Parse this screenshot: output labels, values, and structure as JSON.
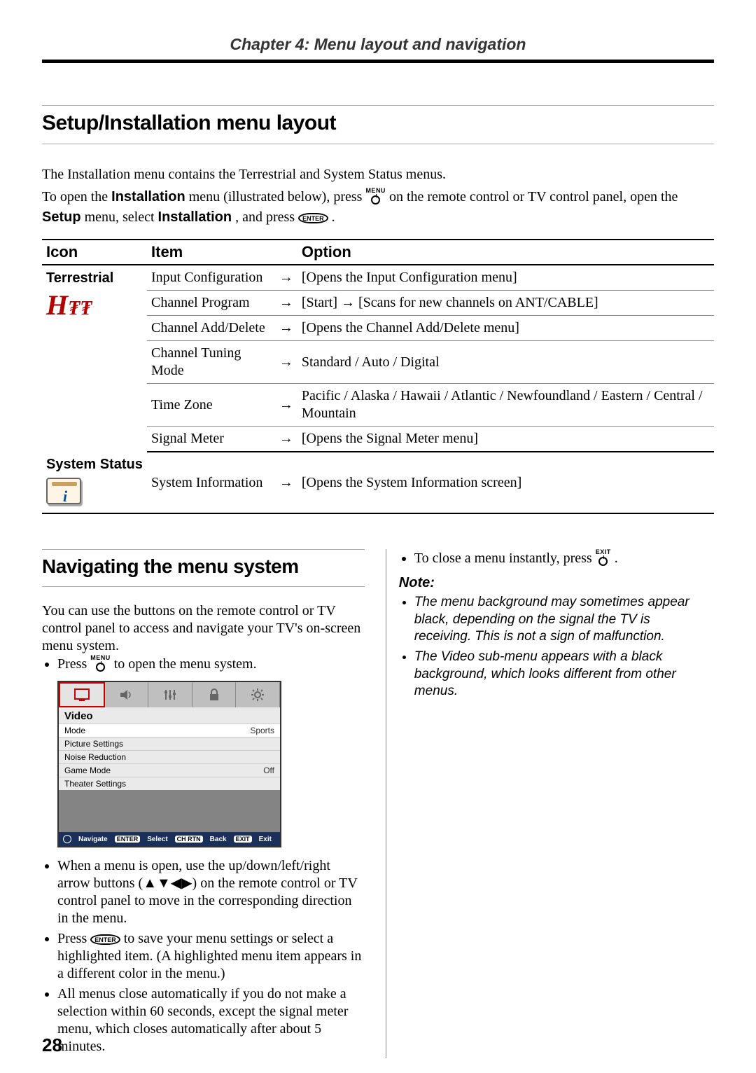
{
  "chapter_header": "Chapter 4: Menu layout and navigation",
  "section1": {
    "title": "Setup/Installation menu layout",
    "para1": "The Installation menu contains the Terrestrial and System Status menus.",
    "para2_a": "To open the ",
    "para2_b": "Installation",
    "para2_c": " menu (illustrated below), press ",
    "para2_d": " on the remote control or TV control panel, open the ",
    "para2_e": "Setup",
    "para2_f": " menu, select ",
    "para2_g": "Installation",
    "para2_h": ", and press ",
    "para2_i": "."
  },
  "buttons": {
    "menu_label": "MENU",
    "exit_label": "EXIT",
    "enter_label": "ENTER"
  },
  "table": {
    "headers": {
      "icon": "Icon",
      "item": "Item",
      "option": "Option"
    },
    "groups": [
      {
        "icon_label": "Terrestrial",
        "icon_type": "terrestrial",
        "rows": [
          {
            "item": "Input Configuration",
            "option": "[Opens the Input Configuration menu]"
          },
          {
            "item": "Channel Program",
            "option": "[Start] → [Scans for new channels on ANT/CABLE]"
          },
          {
            "item": "Channel Add/Delete",
            "option": "[Opens the Channel Add/Delete menu]"
          },
          {
            "item": "Channel Tuning Mode",
            "option": "Standard / Auto / Digital"
          },
          {
            "item": "Time Zone",
            "option": "Pacific / Alaska / Hawaii / Atlantic / Newfoundland / Eastern / Central / Mountain"
          },
          {
            "item": "Signal Meter",
            "option": "[Opens the Signal Meter menu]"
          }
        ]
      },
      {
        "icon_label": "System Status",
        "icon_type": "system",
        "rows": [
          {
            "item": "System Information",
            "option": "[Opens the System Information screen]"
          }
        ]
      }
    ]
  },
  "section2": {
    "title": "Navigating the menu system",
    "intro": "You can use the buttons on the remote control or TV control panel to access and navigate your TV's on-screen menu system.",
    "bullets": [
      {
        "pre": "Press ",
        "button": "MENU",
        "post": " to open the menu system."
      },
      {
        "text": "When a menu is open, use the up/down/left/right arrow buttons (▲▼◀▶) on the remote control or TV control panel to move in the corresponding direction in the menu."
      },
      {
        "pre": "Press ",
        "button": "ENTER",
        "post": " to save your menu settings or select a highlighted item. (A highlighted menu item appears in a different color in the menu.)"
      },
      {
        "text": "All menus close automatically if you do not make a selection within 60 seconds, except the signal meter menu, which closes automatically after about 5 minutes."
      }
    ],
    "right_bullet": {
      "pre": "To close a menu instantly, press ",
      "button": "EXIT",
      "post": "."
    }
  },
  "osd": {
    "title": "Video",
    "rows": [
      {
        "label": "Mode",
        "value": "Sports"
      },
      {
        "label": "Picture Settings",
        "value": ""
      },
      {
        "label": "Noise Reduction",
        "value": ""
      },
      {
        "label": "Game Mode",
        "value": "Off"
      },
      {
        "label": "Theater Settings",
        "value": ""
      }
    ],
    "footer": {
      "navigate": "Navigate",
      "enter": "ENTER",
      "select": "Select",
      "chrtn": "CH RTN",
      "back": "Back",
      "exit": "EXIT",
      "exit_label": "Exit"
    }
  },
  "note": {
    "head": "Note:",
    "items": [
      "The menu background may sometimes appear black, depending on the signal the TV is receiving. This is not a sign of malfunction.",
      "The Video sub-menu appears with a black background, which looks different from other menus."
    ]
  },
  "page_number": "28"
}
